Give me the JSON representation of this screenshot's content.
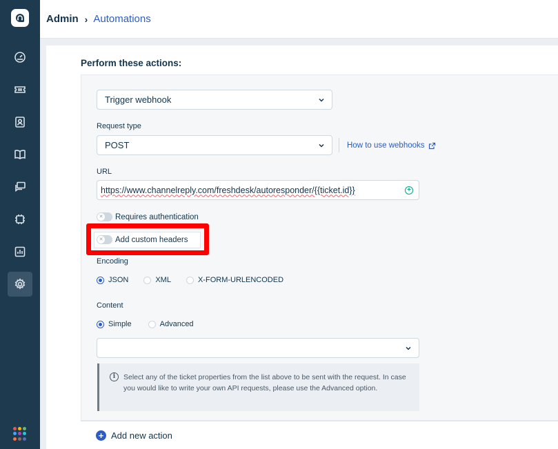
{
  "breadcrumb": {
    "parent": "Admin",
    "separator": "›",
    "current": "Automations"
  },
  "nav": {
    "items": [
      {
        "icon": "dashboard-icon"
      },
      {
        "icon": "tickets-icon"
      },
      {
        "icon": "contacts-icon"
      },
      {
        "icon": "solutions-icon"
      },
      {
        "icon": "forums-icon"
      },
      {
        "icon": "groups-icon"
      },
      {
        "icon": "reports-icon"
      },
      {
        "icon": "admin-gear-icon",
        "active": true
      }
    ],
    "apps_colors": [
      "#ef5350",
      "#ffb300",
      "#66bb6a",
      "#42a5f5",
      "#ab47bc",
      "#26c6da",
      "#ff7043",
      "#8d6e63",
      "#5c6bc0"
    ]
  },
  "section_title": "Perform these actions:",
  "action": {
    "type_value": "Trigger webhook",
    "request_type_label": "Request type",
    "request_type_value": "POST",
    "help_link": "How to use webhooks",
    "url_label": "URL",
    "url_value": "https://www.channelreply.com/freshdesk/autoresponder/{{ticket.id}}",
    "requires_auth_label": "Requires authentication",
    "custom_headers_label": "Add custom headers",
    "encoding_label": "Encoding",
    "encoding_options": [
      "JSON",
      "XML",
      "X-FORM-URLENCODED"
    ],
    "encoding_selected": "JSON",
    "content_label": "Content",
    "content_options": [
      "Simple",
      "Advanced"
    ],
    "content_selected": "Simple",
    "content_select_value": "",
    "info_text": "Select any of the ticket properties from the list above to be sent with the request. In case you would like to write your own API requests, please use the Advanced option."
  },
  "add_action_label": "Add new action",
  "colors": {
    "accent": "#2c5cc5",
    "nav_bg": "#1e3a4f",
    "highlight": "#ff0000"
  }
}
